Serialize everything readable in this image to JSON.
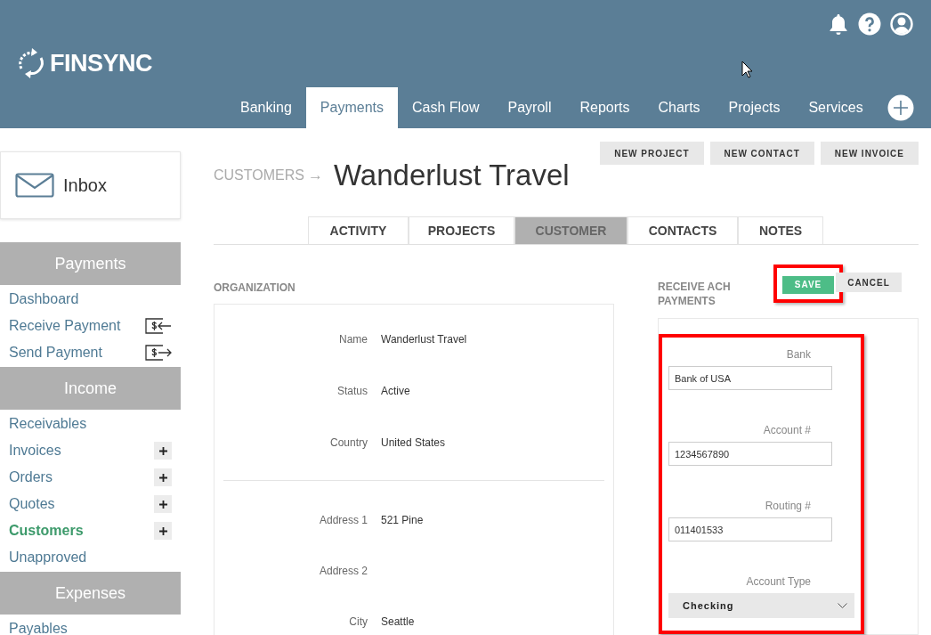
{
  "header": {
    "logo": "FINSYNC",
    "nav": [
      {
        "label": "Banking",
        "selected": false
      },
      {
        "label": "Payments",
        "selected": true
      },
      {
        "label": "Cash Flow",
        "selected": false
      },
      {
        "label": "Payroll",
        "selected": false
      },
      {
        "label": "Reports",
        "selected": false
      },
      {
        "label": "Charts",
        "selected": false
      },
      {
        "label": "Projects",
        "selected": false
      },
      {
        "label": "Services",
        "selected": false
      }
    ]
  },
  "sidebar": {
    "inbox": "Inbox",
    "sections": [
      {
        "title": "Payments",
        "items": [
          {
            "label": "Dashboard",
            "kind": "plain",
            "selected": false
          },
          {
            "label": "Receive Payment",
            "kind": "receive",
            "selected": false
          },
          {
            "label": "Send Payment",
            "kind": "send",
            "selected": false
          }
        ]
      },
      {
        "title": "Income",
        "items": [
          {
            "label": "Receivables",
            "kind": "plain",
            "selected": false
          },
          {
            "label": "Invoices",
            "kind": "add",
            "selected": false
          },
          {
            "label": "Orders",
            "kind": "add",
            "selected": false
          },
          {
            "label": "Quotes",
            "kind": "add",
            "selected": false
          },
          {
            "label": "Customers",
            "kind": "add",
            "selected": true
          },
          {
            "label": "Unapproved",
            "kind": "plain",
            "selected": false
          }
        ]
      },
      {
        "title": "Expenses",
        "items": [
          {
            "label": "Payables",
            "kind": "plain",
            "selected": false
          }
        ]
      }
    ]
  },
  "breadcrumb": {
    "parent": "CUSTOMERS",
    "separator": "→",
    "title": "Wanderlust Travel"
  },
  "actions": [
    "NEW PROJECT",
    "NEW CONTACT",
    "NEW INVOICE"
  ],
  "tabs": [
    {
      "label": "ACTIVITY",
      "selected": false
    },
    {
      "label": "PROJECTS",
      "selected": false
    },
    {
      "label": "CUSTOMER",
      "selected": true
    },
    {
      "label": "CONTACTS",
      "selected": false
    },
    {
      "label": "NOTES",
      "selected": false
    }
  ],
  "organization": {
    "title": "ORGANIZATION",
    "groups": [
      [
        {
          "label": "Name",
          "value": "Wanderlust Travel"
        },
        {
          "label": "Status",
          "value": "Active"
        },
        {
          "label": "Country",
          "value": "United States"
        }
      ],
      [
        {
          "label": "Address 1",
          "value": "521 Pine"
        },
        {
          "label": "Address 2"
        },
        {
          "label": "City",
          "value": "Seattle"
        }
      ]
    ]
  },
  "ach": {
    "title": "RECEIVE ACH PAYMENTS",
    "save": {
      "label": "SAVE",
      "highlighted": true
    },
    "cancel": "CANCEL",
    "highlighted": true,
    "fields": [
      {
        "kind": "text",
        "label": "Bank",
        "value": "Bank of USA"
      },
      {
        "kind": "text",
        "label": "Account #",
        "value": "1234567890"
      },
      {
        "kind": "text",
        "label": "Routing #",
        "value": "011401533"
      },
      {
        "kind": "select",
        "label": "Account Type",
        "value": "Checking"
      }
    ]
  }
}
